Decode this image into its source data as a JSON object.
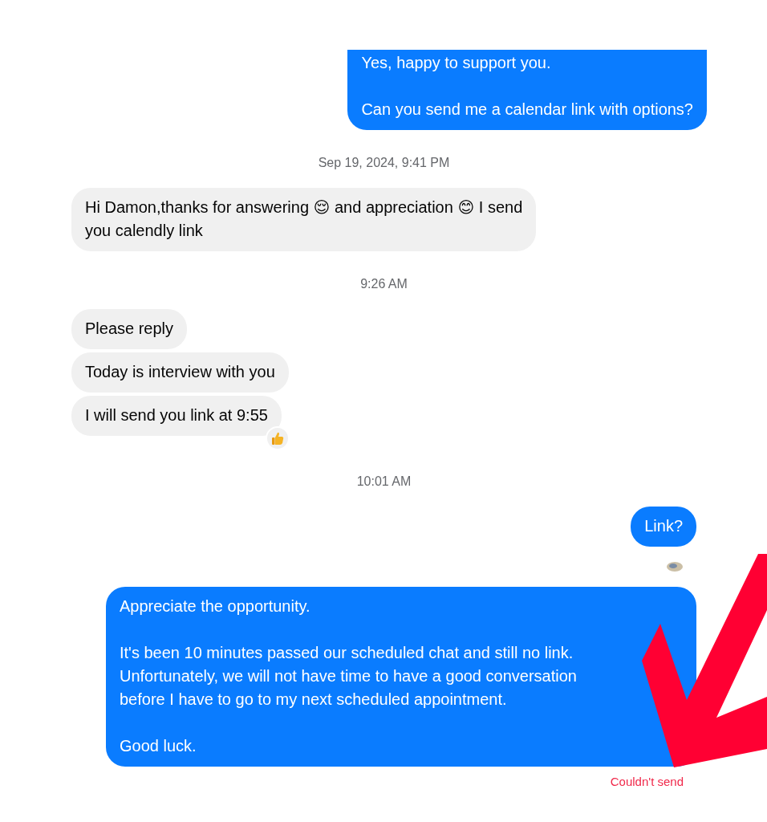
{
  "thread": [
    {
      "kind": "sent",
      "text": "Yes, happy to support you.\n\nCan you send me a calendar link with options?"
    },
    {
      "kind": "timestamp",
      "text": "Sep 19, 2024, 9:41 PM"
    },
    {
      "kind": "received",
      "text": "Hi Damon,thanks for answering 😌 and appreciation 😊 I send\nyou calendly link"
    },
    {
      "kind": "timestamp",
      "text": "9:26 AM"
    },
    {
      "kind": "received",
      "text": "Please reply"
    },
    {
      "kind": "received",
      "text": "Today is interview with you"
    },
    {
      "kind": "received",
      "text": "I will send you link at 9:55",
      "reacted": true
    },
    {
      "kind": "timestamp",
      "text": "10:01 AM"
    },
    {
      "kind": "sent",
      "text": "Link?",
      "seen": true
    },
    {
      "kind": "sent",
      "text": "Appreciate the opportunity.\n\nIt's been 10 minutes passed our scheduled chat and still no link.\nUnfortunately, we will not have time to have a good conversation\nbefore I have to go to my next scheduled appointment.\n\nGood luck.",
      "status": "Couldn't send"
    }
  ]
}
